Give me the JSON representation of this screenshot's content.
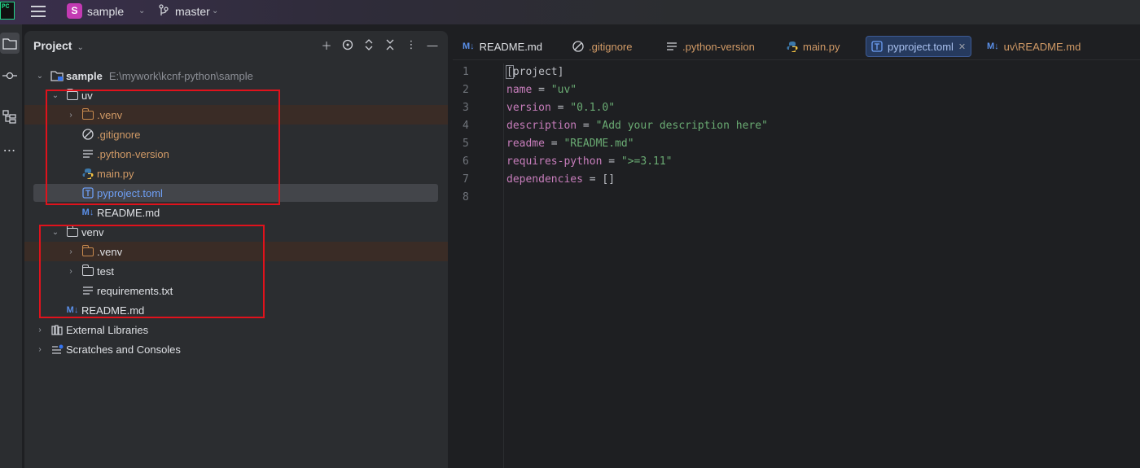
{
  "titlebar": {
    "app_logo": "PC",
    "project_badge": "S",
    "project_name": "sample",
    "branch": "master"
  },
  "project_panel": {
    "title": "Project",
    "tree": [
      {
        "label": "sample",
        "path": "E:\\mywork\\kcnf-python\\sample"
      },
      {
        "label": "uv"
      },
      {
        "label": ".venv"
      },
      {
        "label": ".gitignore"
      },
      {
        "label": ".python-version"
      },
      {
        "label": "main.py"
      },
      {
        "label": "pyproject.toml"
      },
      {
        "label": "README.md"
      },
      {
        "label": "venv"
      },
      {
        "label": ".venv"
      },
      {
        "label": "test"
      },
      {
        "label": "requirements.txt"
      },
      {
        "label": "README.md"
      },
      {
        "label": "External Libraries"
      },
      {
        "label": "Scratches and Consoles"
      }
    ],
    "md_badge": "M↓"
  },
  "editor": {
    "tabs": [
      {
        "label": "README.md"
      },
      {
        "label": ".gitignore"
      },
      {
        "label": ".python-version"
      },
      {
        "label": "main.py"
      },
      {
        "label": "pyproject.toml"
      },
      {
        "label": "uv\\README.md"
      }
    ],
    "line_numbers": [
      "1",
      "2",
      "3",
      "4",
      "5",
      "6",
      "7",
      "8"
    ],
    "code": {
      "l1": "project]",
      "l1_open": "[",
      "l2_key": "name",
      "l2_op": " = ",
      "l2_val": "\"uv\"",
      "l3_key": "version",
      "l3_op": " = ",
      "l3_val": "\"0.1.0\"",
      "l4_key": "description",
      "l4_op": " = ",
      "l4_val": "\"Add your description here\"",
      "l5_key": "readme",
      "l5_op": " = ",
      "l5_val": "\"README.md\"",
      "l6_key": "requires-python",
      "l6_op": " = ",
      "l6_val": "\">=3.11\"",
      "l7_key": "dependencies",
      "l7_op": " = ",
      "l7_val": "[]"
    }
  },
  "colors": {
    "highlight_box": "#e0121c",
    "active_tab": "#263a5e",
    "key": "#c77dbb",
    "string": "#6aab73"
  }
}
